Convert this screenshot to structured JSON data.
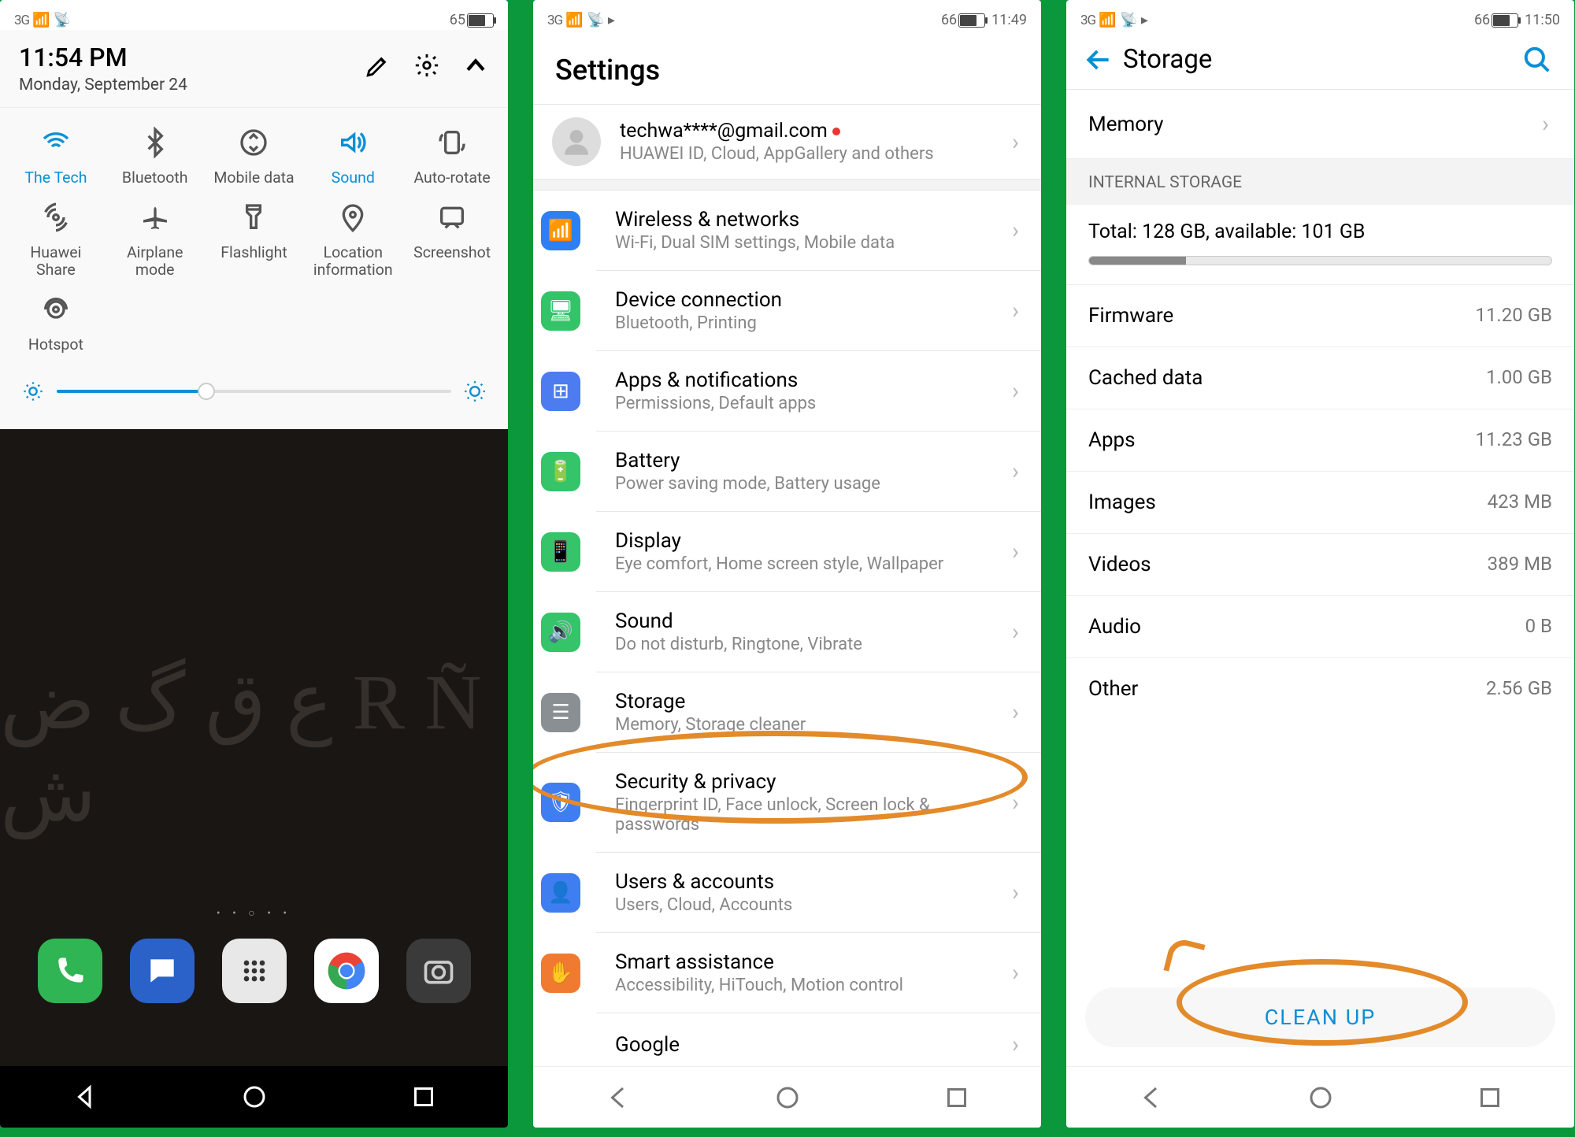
{
  "panel1": {
    "status": {
      "signal": "3G",
      "battery_pct": 65,
      "battery_fill_pct": 65
    },
    "clock": "11:54 PM",
    "date": "Monday, September 24",
    "tiles": [
      {
        "label": "The Tech",
        "active": true
      },
      {
        "label": "Bluetooth",
        "active": false
      },
      {
        "label": "Mobile data",
        "active": false
      },
      {
        "label": "Sound",
        "active": true
      },
      {
        "label": "Auto-rotate",
        "active": false
      },
      {
        "label": "Huawei Share",
        "active": false
      },
      {
        "label": "Airplane mode",
        "active": false
      },
      {
        "label": "Flashlight",
        "active": false
      },
      {
        "label": "Location information",
        "active": false
      },
      {
        "label": "Screenshot",
        "active": false
      },
      {
        "label": "Hotspot",
        "active": false
      }
    ],
    "brightness_pct": 38
  },
  "panel2": {
    "status": {
      "signal": "3G",
      "battery_pct": 66,
      "time": "11:49"
    },
    "title": "Settings",
    "account": {
      "email": "techwa****@gmail.com",
      "sub": "HUAWEI ID, Cloud, AppGallery and others"
    },
    "items": [
      {
        "label": "Wireless & networks",
        "sub": "Wi-Fi, Dual SIM settings, Mobile data",
        "color": "#2d7ff3"
      },
      {
        "label": "Device connection",
        "sub": "Bluetooth, Printing",
        "color": "#33c46a"
      },
      {
        "label": "Apps & notifications",
        "sub": "Permissions, Default apps",
        "color": "#4d7cf0"
      },
      {
        "label": "Battery",
        "sub": "Power saving mode, Battery usage",
        "color": "#35c46a"
      },
      {
        "label": "Display",
        "sub": "Eye comfort, Home screen style, Wallpaper",
        "color": "#35c46a"
      },
      {
        "label": "Sound",
        "sub": "Do not disturb, Ringtone, Vibrate",
        "color": "#35c46a"
      },
      {
        "label": "Storage",
        "sub": "Memory, Storage cleaner",
        "color": "#8a8f94"
      },
      {
        "label": "Security & privacy",
        "sub": "Fingerprint ID, Face unlock, Screen lock & passwords",
        "color": "#3f7ef0"
      },
      {
        "label": "Users & accounts",
        "sub": "Users, Cloud, Accounts",
        "color": "#3f7ef0"
      },
      {
        "label": "Smart assistance",
        "sub": "Accessibility, HiTouch, Motion control",
        "color": "#f07b30"
      },
      {
        "label": "Google",
        "sub": "",
        "color": "#fff"
      }
    ]
  },
  "panel3": {
    "status": {
      "signal": "3G",
      "battery_pct": 66,
      "time": "11:50"
    },
    "title": "Storage",
    "memory_label": "Memory",
    "section": "INTERNAL STORAGE",
    "total_line": "Total: 128 GB, available: 101 GB",
    "used_pct": 21,
    "rows": [
      {
        "label": "Firmware",
        "val": "11.20 GB"
      },
      {
        "label": "Cached data",
        "val": "1.00 GB"
      },
      {
        "label": "Apps",
        "val": "11.23 GB"
      },
      {
        "label": "Images",
        "val": "423 MB"
      },
      {
        "label": "Videos",
        "val": "389 MB"
      },
      {
        "label": "Audio",
        "val": "0 B"
      },
      {
        "label": "Other",
        "val": "2.56 GB"
      }
    ],
    "cleanup": "CLEAN UP"
  }
}
